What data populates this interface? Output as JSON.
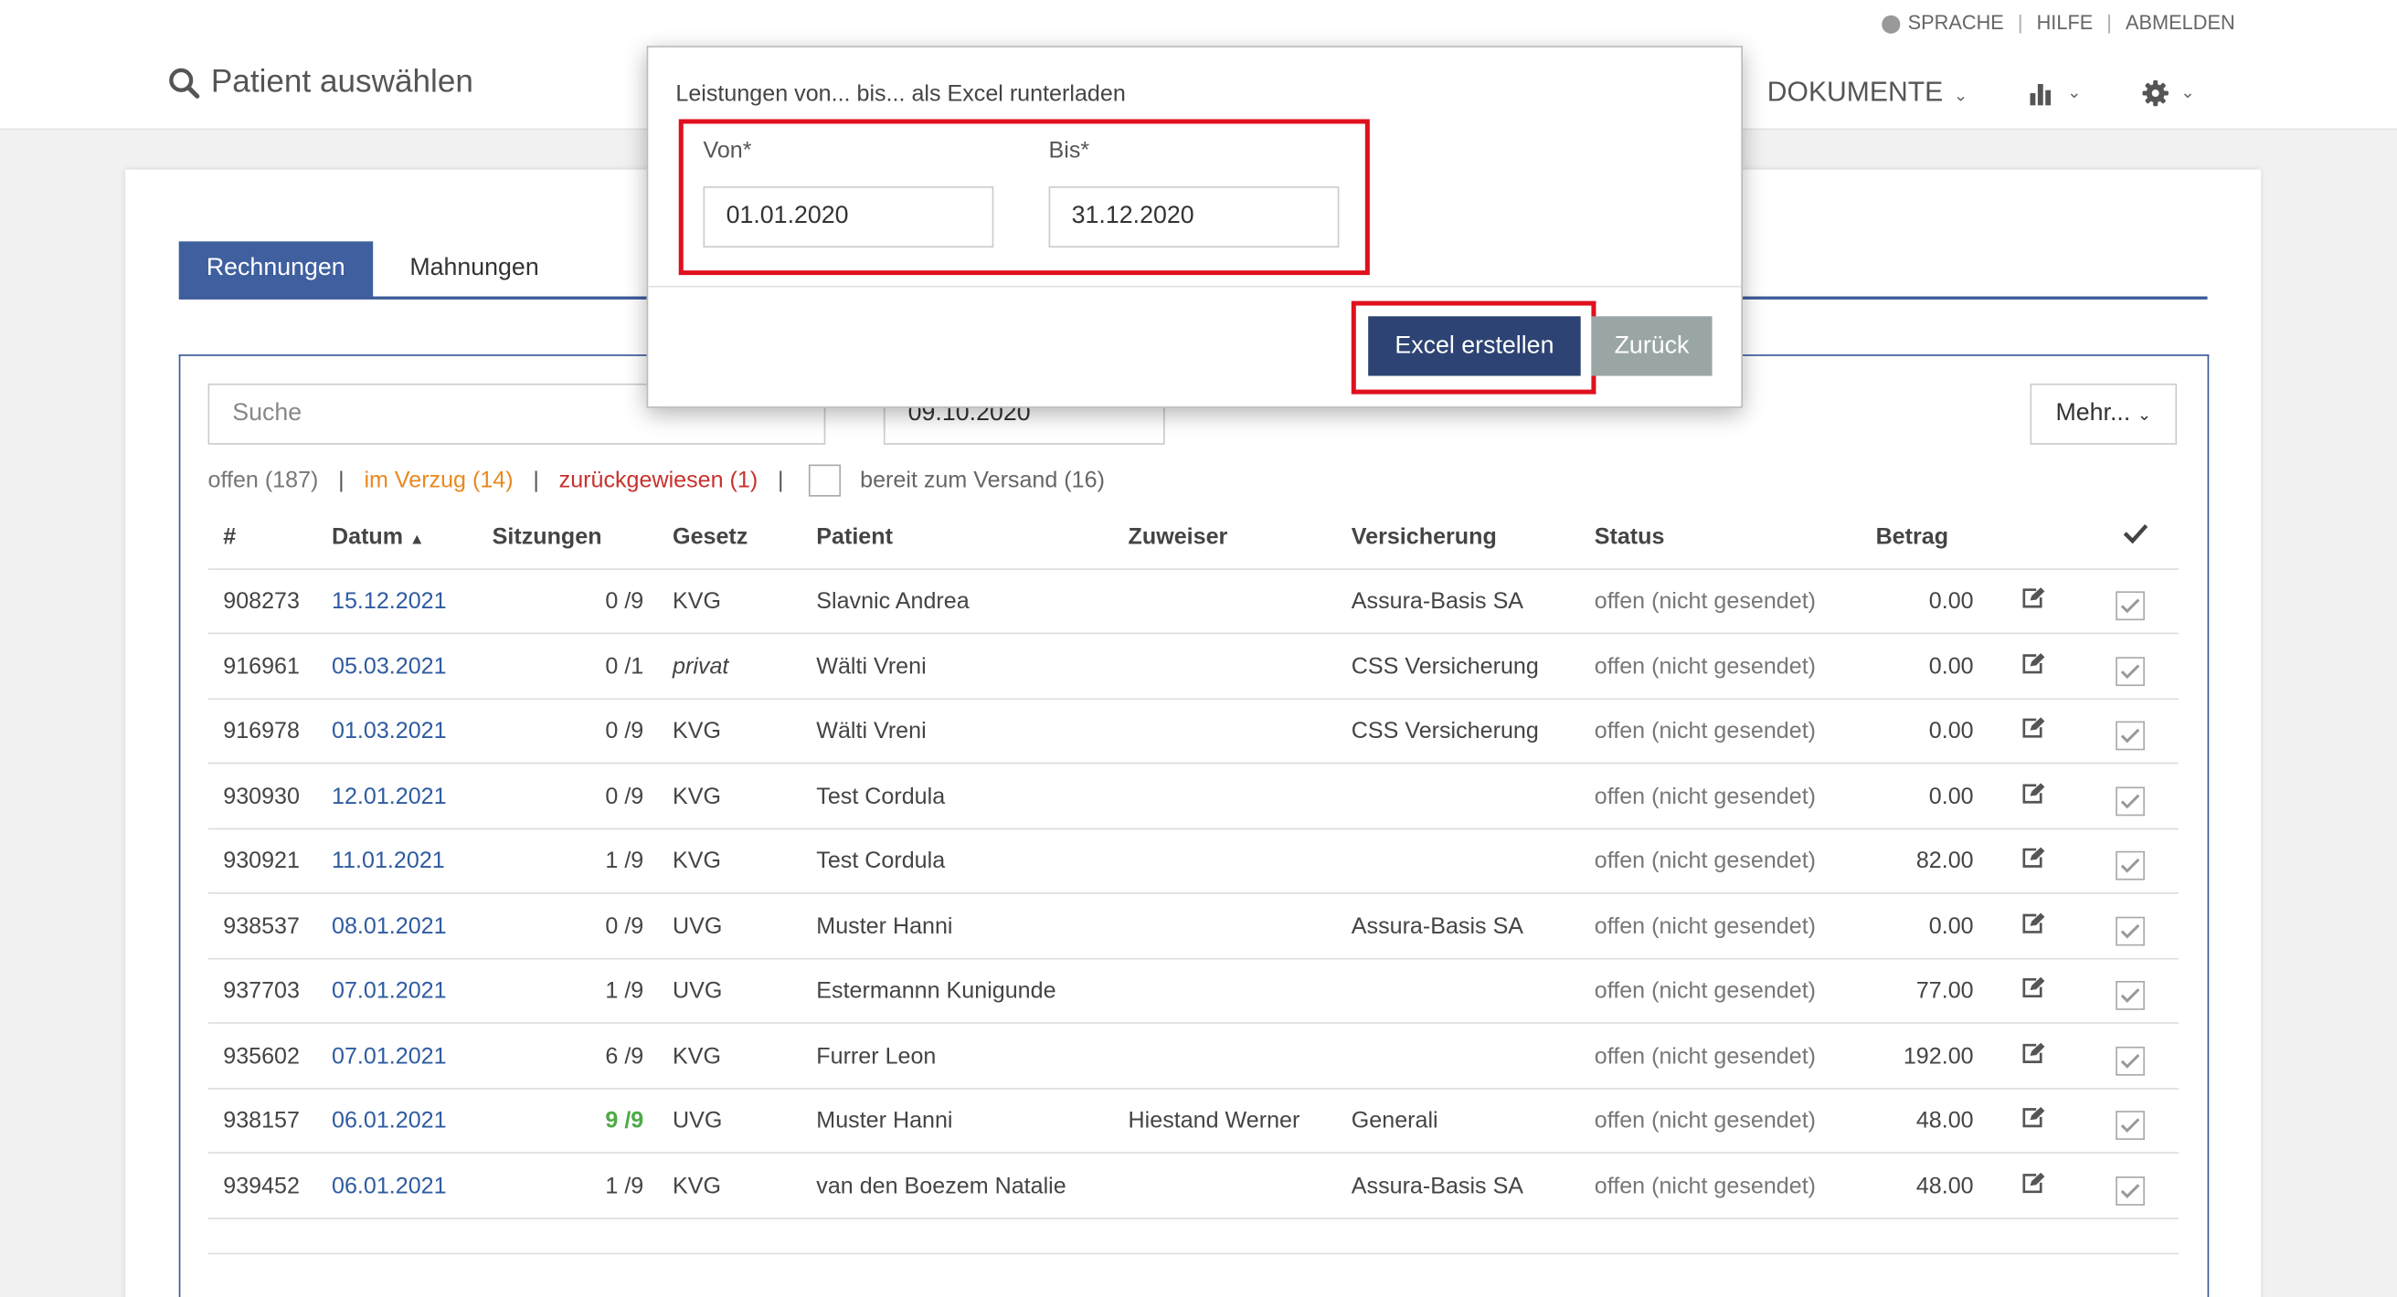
{
  "header": {
    "sprache": "SPRACHE",
    "hilfe": "HILFE",
    "abmelden": "ABMELDEN",
    "sep": "|",
    "patient_search": "Patient auswählen",
    "nav_dokumente": "DOKUMENTE"
  },
  "tabs": [
    "Rechnungen",
    "Mahnungen"
  ],
  "search": {
    "placeholder": "Suche",
    "date": "09.10.2020",
    "mehr": "Mehr..."
  },
  "filters": {
    "offen": "offen (187)",
    "verzug": "im Verzug (14)",
    "zurueck": "zurückgewiesen (1)",
    "bereit": "bereit zum Versand (16)",
    "sep": "|"
  },
  "table": {
    "headers": [
      "#",
      "Datum",
      "Sitzungen",
      "Gesetz",
      "Patient",
      "Zuweiser",
      "Versicherung",
      "Status",
      "Betrag"
    ],
    "rows": [
      {
        "num": "908273",
        "date": "15.12.2021",
        "sitz": "0 /9",
        "gesetz": "KVG",
        "patient": "Slavnic Andrea",
        "zuweiser": "",
        "vers": "Assura-Basis SA",
        "status": "offen (nicht gesendet)",
        "betrag": "0.00"
      },
      {
        "num": "916961",
        "date": "05.03.2021",
        "sitz": "0 /1",
        "gesetz": "privat",
        "patient": "Wälti Vreni",
        "zuweiser": "",
        "vers": "CSS Versicherung",
        "status": "offen (nicht gesendet)",
        "betrag": "0.00"
      },
      {
        "num": "916978",
        "date": "01.03.2021",
        "sitz": "0 /9",
        "gesetz": "KVG",
        "patient": "Wälti Vreni",
        "zuweiser": "",
        "vers": "CSS Versicherung",
        "status": "offen (nicht gesendet)",
        "betrag": "0.00"
      },
      {
        "num": "930930",
        "date": "12.01.2021",
        "sitz": "0 /9",
        "gesetz": "KVG",
        "patient": "Test Cordula",
        "zuweiser": "",
        "vers": "",
        "status": "offen (nicht gesendet)",
        "betrag": "0.00"
      },
      {
        "num": "930921",
        "date": "11.01.2021",
        "sitz": "1 /9",
        "gesetz": "KVG",
        "patient": "Test Cordula",
        "zuweiser": "",
        "vers": "",
        "status": "offen (nicht gesendet)",
        "betrag": "82.00"
      },
      {
        "num": "938537",
        "date": "08.01.2021",
        "sitz": "0 /9",
        "gesetz": "UVG",
        "patient": "Muster Hanni",
        "zuweiser": "",
        "vers": "Assura-Basis SA",
        "status": "offen (nicht gesendet)",
        "betrag": "0.00"
      },
      {
        "num": "937703",
        "date": "07.01.2021",
        "sitz": "1 /9",
        "gesetz": "UVG",
        "patient": "Estermannn Kunigunde",
        "zuweiser": "",
        "vers": "",
        "status": "offen (nicht gesendet)",
        "betrag": "77.00"
      },
      {
        "num": "935602",
        "date": "07.01.2021",
        "sitz": "6 /9",
        "gesetz": "KVG",
        "patient": "Furrer Leon",
        "zuweiser": "",
        "vers": "",
        "status": "offen (nicht gesendet)",
        "betrag": "192.00"
      },
      {
        "num": "938157",
        "date": "06.01.2021",
        "sitz": "9 /9",
        "gesetz": "UVG",
        "patient": "Muster Hanni",
        "zuweiser": "Hiestand Werner",
        "vers": "Generali",
        "status": "offen (nicht gesendet)",
        "betrag": "48.00"
      },
      {
        "num": "939452",
        "date": "06.01.2021",
        "sitz": "1 /9",
        "gesetz": "KVG",
        "patient": "van den Boezem Natalie",
        "zuweiser": "",
        "vers": "Assura-Basis SA",
        "status": "offen (nicht gesendet)",
        "betrag": "48.00"
      }
    ]
  },
  "modal": {
    "title": "Leistungen von... bis... als Excel runterladen",
    "von_label": "Von*",
    "bis_label": "Bis*",
    "von_value": "01.01.2020",
    "bis_value": "31.12.2020",
    "excel_button": "Excel erstellen",
    "back_button": "Zurück"
  },
  "colors": {
    "primary": "#3f5f9f",
    "excel_button": "#2d4373",
    "back_button": "#9aa6a5",
    "highlight": "#e0101e",
    "link": "#2e5ba0",
    "verzug": "#e8891e",
    "zurueck": "#c9302c",
    "sitzungen_complete": "#4caa45"
  },
  "icons": [
    "globe-icon",
    "search-icon",
    "chevron-down-icon",
    "bar-chart-icon",
    "gear-icon",
    "sort-asc-icon",
    "checkmark-icon",
    "edit-icon",
    "checkbox-checked-icon"
  ]
}
